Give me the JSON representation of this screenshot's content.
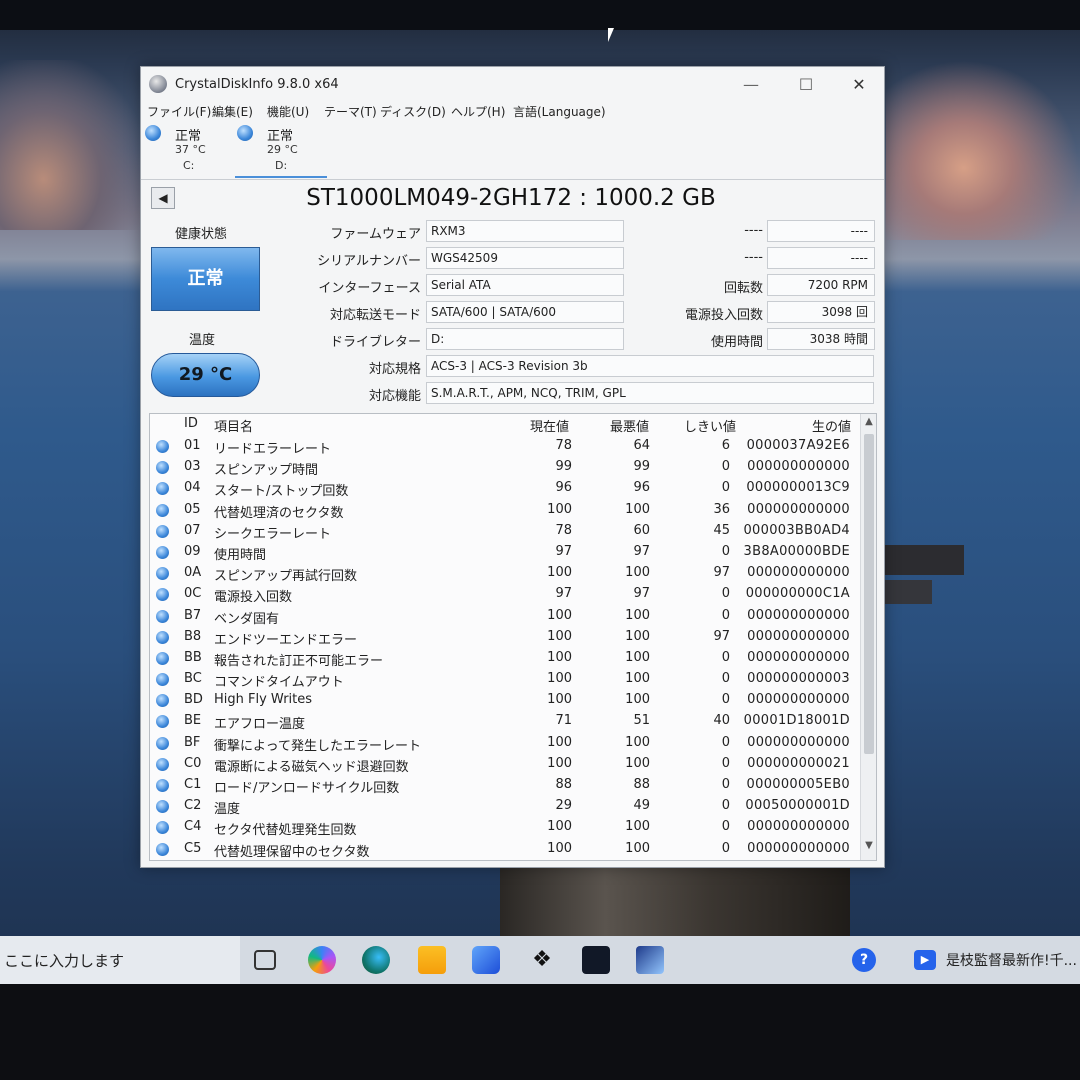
{
  "window": {
    "title": "CrystalDiskInfo 9.8.0 x64",
    "minimize": "—",
    "maximize": "☐",
    "close": "✕"
  },
  "menu": [
    "ファイル(F)",
    "編集(E)",
    "機能(U)",
    "テーマ(T)",
    "ディスク(D)",
    "ヘルプ(H)",
    "言語(Language)"
  ],
  "drives": [
    {
      "status": "正常",
      "temp": "37 °C",
      "letter": "C:"
    },
    {
      "status": "正常",
      "temp": "29 °C",
      "letter": "D:"
    }
  ],
  "disk": {
    "nav_prev": "◀",
    "model": "ST1000LM049-2GH172 : 1000.2 GB",
    "health_label": "健康状態",
    "health_value": "正常",
    "temp_label": "温度",
    "temp_value": "29 °C",
    "firmware_label": "ファームウェア",
    "firmware": "RXM3",
    "serial_label": "シリアルナンバー",
    "serial": "WGS42509",
    "interface_label": "インターフェース",
    "interface": "Serial ATA",
    "transfer_label": "対応転送モード",
    "transfer": "SATA/600 | SATA/600",
    "drive_letter_label": "ドライブレター",
    "drive_letter": "D:",
    "standard_label": "対応規格",
    "standard": "ACS-3 | ACS-3 Revision 3b",
    "features_label": "対応機能",
    "features": "S.M.A.R.T., APM, NCQ, TRIM, GPL",
    "blank1_label": "----",
    "blank1": "----",
    "blank2_label": "----",
    "blank2": "----",
    "rotation_label": "回転数",
    "rotation": "7200 RPM",
    "power_count_label": "電源投入回数",
    "power_count": "3098 回",
    "power_hours_label": "使用時間",
    "power_hours": "3038 時間"
  },
  "smart": {
    "headers": {
      "id": "ID",
      "name": "項目名",
      "current": "現在値",
      "worst": "最悪値",
      "threshold": "しきい値",
      "raw": "生の値"
    },
    "rows": [
      {
        "id": "01",
        "name": "リードエラーレート",
        "current": "78",
        "worst": "64",
        "threshold": "6",
        "raw": "0000037A92E6"
      },
      {
        "id": "03",
        "name": "スピンアップ時間",
        "current": "99",
        "worst": "99",
        "threshold": "0",
        "raw": "000000000000"
      },
      {
        "id": "04",
        "name": "スタート/ストップ回数",
        "current": "96",
        "worst": "96",
        "threshold": "0",
        "raw": "0000000013C9"
      },
      {
        "id": "05",
        "name": "代替処理済のセクタ数",
        "current": "100",
        "worst": "100",
        "threshold": "36",
        "raw": "000000000000"
      },
      {
        "id": "07",
        "name": "シークエラーレート",
        "current": "78",
        "worst": "60",
        "threshold": "45",
        "raw": "000003BB0AD4"
      },
      {
        "id": "09",
        "name": "使用時間",
        "current": "97",
        "worst": "97",
        "threshold": "0",
        "raw": "3B8A00000BDE"
      },
      {
        "id": "0A",
        "name": "スピンアップ再試行回数",
        "current": "100",
        "worst": "100",
        "threshold": "97",
        "raw": "000000000000"
      },
      {
        "id": "0C",
        "name": "電源投入回数",
        "current": "97",
        "worst": "97",
        "threshold": "0",
        "raw": "000000000C1A"
      },
      {
        "id": "B7",
        "name": "ベンダ固有",
        "current": "100",
        "worst": "100",
        "threshold": "0",
        "raw": "000000000000"
      },
      {
        "id": "B8",
        "name": "エンドツーエンドエラー",
        "current": "100",
        "worst": "100",
        "threshold": "97",
        "raw": "000000000000"
      },
      {
        "id": "BB",
        "name": "報告された訂正不可能エラー",
        "current": "100",
        "worst": "100",
        "threshold": "0",
        "raw": "000000000000"
      },
      {
        "id": "BC",
        "name": "コマンドタイムアウト",
        "current": "100",
        "worst": "100",
        "threshold": "0",
        "raw": "000000000003"
      },
      {
        "id": "BD",
        "name": "High Fly Writes",
        "current": "100",
        "worst": "100",
        "threshold": "0",
        "raw": "000000000000"
      },
      {
        "id": "BE",
        "name": "エアフロー温度",
        "current": "71",
        "worst": "51",
        "threshold": "40",
        "raw": "00001D18001D"
      },
      {
        "id": "BF",
        "name": "衝撃によって発生したエラーレート",
        "current": "100",
        "worst": "100",
        "threshold": "0",
        "raw": "000000000000"
      },
      {
        "id": "C0",
        "name": "電源断による磁気ヘッド退避回数",
        "current": "100",
        "worst": "100",
        "threshold": "0",
        "raw": "000000000021"
      },
      {
        "id": "C1",
        "name": "ロード/アンロードサイクル回数",
        "current": "88",
        "worst": "88",
        "threshold": "0",
        "raw": "000000005EB0"
      },
      {
        "id": "C2",
        "name": "温度",
        "current": "29",
        "worst": "49",
        "threshold": "0",
        "raw": "00050000001D"
      },
      {
        "id": "C4",
        "name": "セクタ代替処理発生回数",
        "current": "100",
        "worst": "100",
        "threshold": "0",
        "raw": "000000000000"
      },
      {
        "id": "C5",
        "name": "代替処理保留中のセクタ数",
        "current": "100",
        "worst": "100",
        "threshold": "0",
        "raw": "000000000000"
      }
    ]
  },
  "taskbar": {
    "search_text": "ここに入力します",
    "dropbox_glyph": "❖",
    "help_glyph": "?",
    "news_icon": "▶",
    "news_text": "是枝監督最新作!千..."
  }
}
